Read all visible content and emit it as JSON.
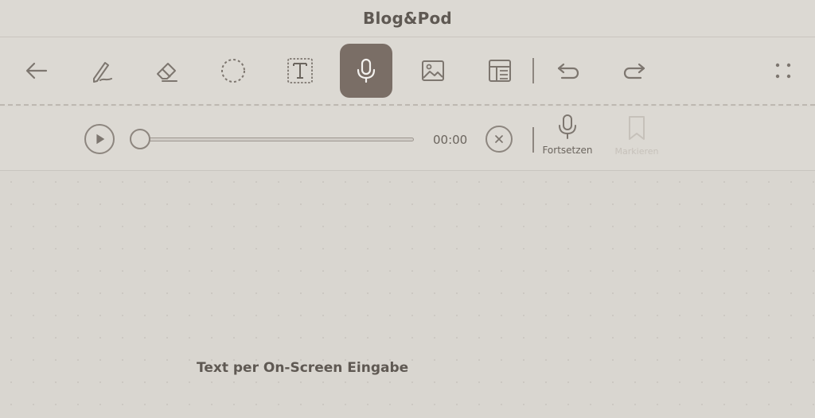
{
  "app": {
    "title": "Blog&Pod"
  },
  "toolbar": {
    "tools": [
      {
        "icon": "back-arrow-icon"
      },
      {
        "icon": "pen-icon"
      },
      {
        "icon": "eraser-icon"
      },
      {
        "icon": "lasso-select-icon"
      },
      {
        "icon": "text-box-icon"
      },
      {
        "icon": "microphone-icon",
        "active": true
      },
      {
        "icon": "image-icon"
      },
      {
        "icon": "layout-template-icon"
      },
      {
        "icon": "undo-icon"
      },
      {
        "icon": "redo-icon"
      },
      {
        "icon": "more-options-icon"
      }
    ],
    "active_color": "#7a6e66"
  },
  "audio": {
    "time": "00:00",
    "progress": 0,
    "record_label": "Fortsetzen",
    "bookmark_label": "Markieren"
  },
  "canvas": {
    "hint_text": "Text per On-Screen Eingabe"
  }
}
